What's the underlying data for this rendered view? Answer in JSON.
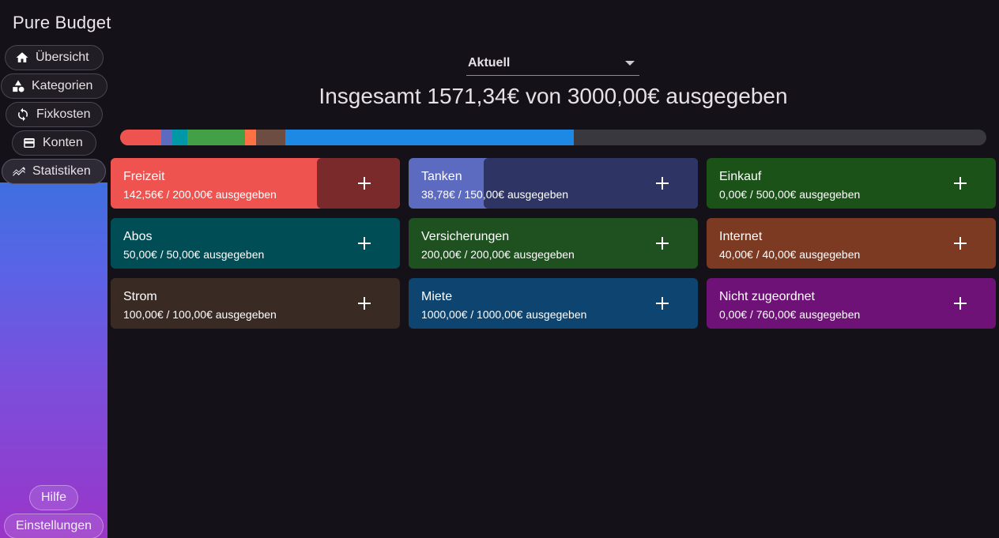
{
  "app": {
    "title": "Pure Budget"
  },
  "nav": {
    "items": [
      {
        "label": "Übersicht",
        "icon": "home-icon"
      },
      {
        "label": "Kategorien",
        "icon": "shapes-icon"
      },
      {
        "label": "Fixkosten",
        "icon": "sync-icon"
      },
      {
        "label": "Konten",
        "icon": "wallet-icon"
      },
      {
        "label": "Statistiken",
        "icon": "chart-icon"
      }
    ],
    "active": "Statistiken",
    "help_label": "Hilfe",
    "settings_label": "Einstellungen"
  },
  "period": {
    "selected": "Aktuell"
  },
  "summary": {
    "text": "Insgesamt 1571,34€ von 3000,00€ ausgegeben",
    "spent": 1571.34,
    "total": 3000.0
  },
  "categories": [
    {
      "name": "Freizeit",
      "sub": "142,56€ / 200,00€ ausgegeben",
      "spent": 142.56,
      "budget": 200.0,
      "color": "#ef5350",
      "dark": "#7b2a2b"
    },
    {
      "name": "Tanken",
      "sub": "38,78€ / 150,00€ ausgegeben",
      "spent": 38.78,
      "budget": 150.0,
      "color": "#5c6bc0",
      "dark": "#2e3464"
    },
    {
      "name": "Einkauf",
      "sub": "0,00€ / 500,00€ ausgegeben",
      "spent": 0.0,
      "budget": 500.0,
      "color": "#43a047",
      "dark": "#1b5218"
    },
    {
      "name": "Abos",
      "sub": "50,00€ / 50,00€ ausgegeben",
      "spent": 50.0,
      "budget": 50.0,
      "color": "#004d55",
      "dark": "#004d55"
    },
    {
      "name": "Versicherungen",
      "sub": "200,00€ / 200,00€ ausgegeben",
      "spent": 200.0,
      "budget": 200.0,
      "color": "#1f5120",
      "dark": "#1f5120"
    },
    {
      "name": "Internet",
      "sub": "40,00€ / 40,00€ ausgegeben",
      "spent": 40.0,
      "budget": 40.0,
      "color": "#7d3a22",
      "dark": "#7d3a22"
    },
    {
      "name": "Strom",
      "sub": "100,00€ / 100,00€ ausgegeben",
      "spent": 100.0,
      "budget": 100.0,
      "color": "#3a2a24",
      "dark": "#3a2a24"
    },
    {
      "name": "Miete",
      "sub": "1000,00€ / 1000,00€ ausgegeben",
      "spent": 1000.0,
      "budget": 1000.0,
      "color": "#0e4470",
      "dark": "#0e4470"
    },
    {
      "name": "Nicht zugeordnet",
      "sub": "0,00€ / 760,00€ ausgegeben",
      "spent": 0.0,
      "budget": 760.0,
      "color": "#6e1278",
      "dark": "#6e1278"
    }
  ],
  "progress_segments": [
    {
      "category": "Freizeit",
      "amount": 142.56,
      "color": "#ef5350"
    },
    {
      "category": "Tanken",
      "amount": 38.78,
      "color": "#5c6bc0"
    },
    {
      "category": "Abos",
      "amount": 50.0,
      "color": "#0097a7"
    },
    {
      "category": "Versicherungen",
      "amount": 200.0,
      "color": "#43a047"
    },
    {
      "category": "Internet",
      "amount": 40.0,
      "color": "#ff7043"
    },
    {
      "category": "Strom",
      "amount": 100.0,
      "color": "#6d4c41"
    },
    {
      "category": "Miete",
      "amount": 1000.0,
      "color": "#1e88e5"
    }
  ],
  "colors": {
    "background": "#141218",
    "track": "#3a383f"
  }
}
